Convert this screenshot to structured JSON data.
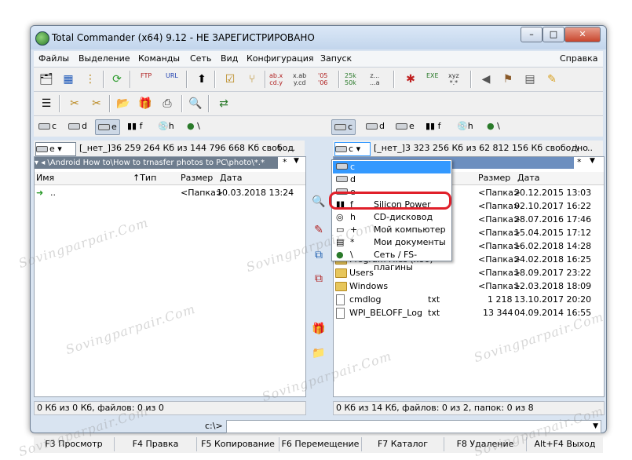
{
  "window": {
    "title": "Total Commander (x64) 9.12 - НЕ ЗАРЕГИСТРИРОВАНО",
    "min_label": "–",
    "max_label": "□",
    "close_label": "✕"
  },
  "menu": [
    "Файлы",
    "Выделение",
    "Команды",
    "Сеть",
    "Вид",
    "Конфигурация",
    "Запуск",
    "Справка"
  ],
  "toolbar_text": {
    "ftp": "FTP",
    "url": "URL",
    "abxab_1": "ab.x",
    "abxab_2": "cd.y",
    "xab_1": "x.ab",
    "xab_2": "y.cd",
    "y05_1": "'05",
    "y05_2": "'06",
    "k25_1": "25k",
    "k25_2": "50k",
    "z_1": "z...",
    "z_2": "...a",
    "exe": "EXE",
    "xyz_1": "xyz",
    "xyz_2": "*.*"
  },
  "left": {
    "drives": [
      "c",
      "d",
      "e",
      "f",
      "h"
    ],
    "active_drive": "e",
    "drive_combo": "e",
    "volume": "[_нет_]",
    "free": "36 259 264 Кб из 144 796 668 Кб свобод",
    "root": "\\",
    "up": "..",
    "path": "▾ ◂ \\Android How to\\How to trnasfer photos to PC\\photo\\*.*",
    "path_star": "*",
    "columns": [
      "Имя",
      "↑Тип",
      "Размер",
      "Дата"
    ],
    "rows": [
      {
        "name": "..",
        "type": "",
        "size": "<Папка>",
        "date": "10.03.2018 13:24"
      }
    ],
    "status": "0 Кб из 0 Кб, файлов: 0 из 0"
  },
  "right": {
    "drives": [
      "c",
      "d",
      "e",
      "f",
      "h"
    ],
    "active_drive": "c",
    "drive_combo": "c",
    "volume": "[_нет_]",
    "free": "3 323 256 Кб из 62 812 156 Кб свободно",
    "root": "\\",
    "up": "..",
    "path_star": "*",
    "columns": [
      "Размер",
      "Дата"
    ],
    "rows": [
      {
        "name": "",
        "type": "",
        "size": "<Папка>",
        "date": "20.12.2015 13:03",
        "icon": "folder"
      },
      {
        "name": "",
        "type": "",
        "size": "<Папка>",
        "date": "02.10.2017 16:22",
        "icon": "folder"
      },
      {
        "name": "",
        "type": "",
        "size": "<Папка>",
        "date": "28.07.2016 17:46",
        "icon": "folder"
      },
      {
        "name": "",
        "type": "",
        "size": "<Папка>",
        "date": "15.04.2015 17:12",
        "icon": "folder"
      },
      {
        "name": "",
        "type": "",
        "size": "<Папка>",
        "date": "16.02.2018 14:28",
        "icon": "folder"
      },
      {
        "name": "Program Files (x86)",
        "type": "",
        "size": "<Папка>",
        "date": "24.02.2018 16:25",
        "icon": "folder"
      },
      {
        "name": "Users",
        "type": "",
        "size": "<Папка>",
        "date": "18.09.2017 23:22",
        "icon": "folder"
      },
      {
        "name": "Windows",
        "type": "",
        "size": "<Папка>",
        "date": "12.03.2018 18:09",
        "icon": "folder"
      },
      {
        "name": "cmdlog",
        "type": "txt",
        "size": "1 218",
        "date": "13.10.2017 20:20",
        "icon": "file"
      },
      {
        "name": "WPI_BELOFF_Log",
        "type": "txt",
        "size": "13 344",
        "date": "04.09.2014 16:55",
        "icon": "file"
      }
    ],
    "status": "0 Кб из 14 Кб, файлов: 0 из 2, папок: 0 из 8"
  },
  "dropdown": [
    {
      "letter": "c",
      "name": ""
    },
    {
      "letter": "d",
      "name": ""
    },
    {
      "letter": "e",
      "name": ""
    },
    {
      "letter": "f",
      "name": "Silicon Power"
    },
    {
      "letter": "h",
      "name": "CD-дисковод"
    },
    {
      "letter": "+",
      "name": "Мой компьютер"
    },
    {
      "letter": "*",
      "name": "Мои документы"
    },
    {
      "letter": "\\",
      "name": "Сеть / FS-плагины"
    }
  ],
  "cmdline": {
    "prompt": "c:\\>",
    "value": ""
  },
  "fkeys": [
    "F3 Просмотр",
    "F4 Правка",
    "F5 Копирование",
    "F6 Перемещение",
    "F7 Каталог",
    "F8 Удаление",
    "Alt+F4 Выход"
  ],
  "watermark": "Sovingparpair.Com",
  "colors": {
    "accent": "#3399ff",
    "highlight": "#e0202a",
    "folder": "#e7c65b"
  }
}
